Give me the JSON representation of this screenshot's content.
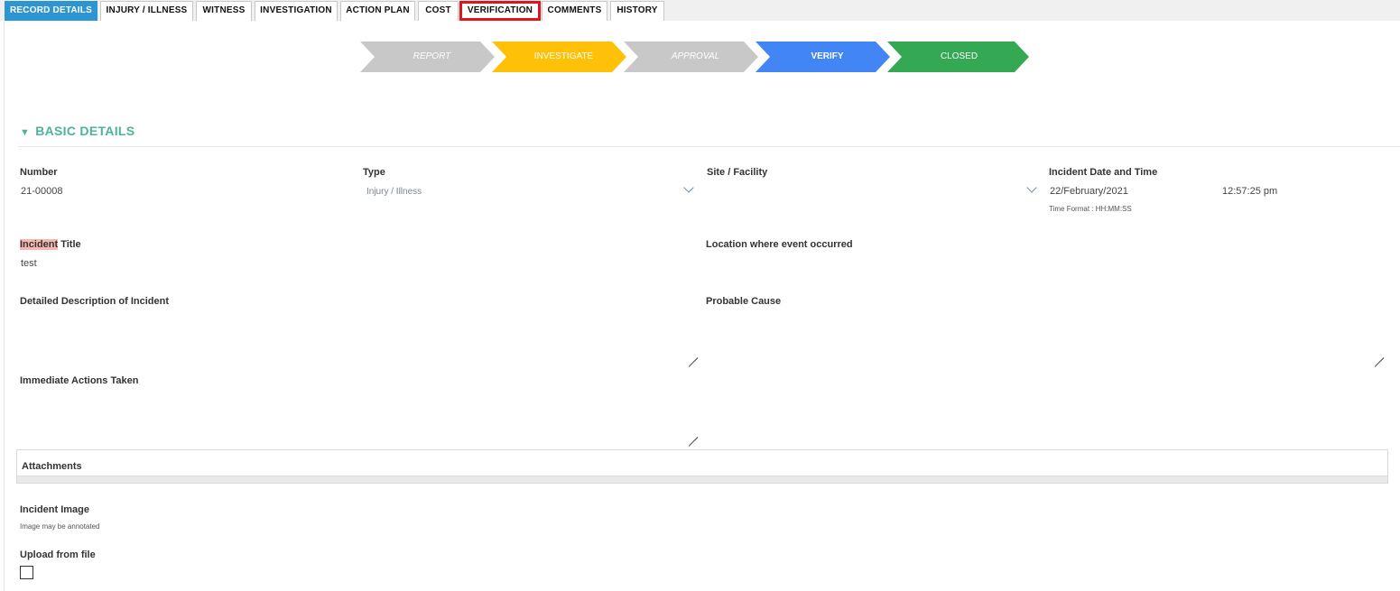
{
  "tabs": [
    {
      "label": "RECORD DETAILS",
      "state": "active"
    },
    {
      "label": "INJURY / ILLNESS",
      "state": "normal"
    },
    {
      "label": "WITNESS",
      "state": "normal"
    },
    {
      "label": "INVESTIGATION",
      "state": "normal"
    },
    {
      "label": "ACTION PLAN",
      "state": "normal"
    },
    {
      "label": "COST",
      "state": "normal"
    },
    {
      "label": "VERIFICATION",
      "state": "highlighted"
    },
    {
      "label": "COMMENTS",
      "state": "normal"
    },
    {
      "label": "HISTORY",
      "state": "normal"
    }
  ],
  "workflow": [
    {
      "label": "REPORT",
      "color": "#c8c8c8",
      "italic": true,
      "bold": false
    },
    {
      "label": "INVESTIGATE",
      "color": "#ffc107",
      "italic": false,
      "bold": false
    },
    {
      "label": "APPROVAL",
      "color": "#c8c8c8",
      "italic": true,
      "bold": false
    },
    {
      "label": "VERIFY",
      "color": "#4285f4",
      "italic": false,
      "bold": true
    },
    {
      "label": "CLOSED",
      "color": "#34a853",
      "italic": false,
      "bold": false
    }
  ],
  "section": {
    "title": "BASIC DETAILS",
    "toggle_icon": "triangle-down-icon",
    "color": "#4db39a"
  },
  "fields": {
    "number": {
      "label": "Number",
      "value": "21-00008"
    },
    "type": {
      "label": "Type",
      "value": "Injury / Illness"
    },
    "site": {
      "label": "Site / Facility",
      "value": ""
    },
    "incident_datetime": {
      "label": "Incident Date and Time",
      "date": "22/February/2021",
      "time": "12:57:25 pm",
      "hint": "Time Format : HH:MM:SS"
    },
    "incident_title": {
      "label_highlight": "Incident",
      "label_rest": " Title",
      "value": "test"
    },
    "location": {
      "label": "Location where event occurred",
      "value": ""
    },
    "description": {
      "label": "Detailed Description of Incident",
      "value": ""
    },
    "probable_cause": {
      "label": "Probable Cause",
      "value": ""
    },
    "immediate_actions": {
      "label": "Immediate Actions Taken",
      "value": ""
    }
  },
  "attachments": {
    "label": "Attachments"
  },
  "incident_image": {
    "label": "Incident Image",
    "hint": "Image may be annotated"
  },
  "upload": {
    "label": "Upload from file",
    "checked": false
  },
  "colors": {
    "tab_active": "#2e95d3",
    "highlight_border": "#e0141b",
    "label_highlight": "#f6b7b3"
  }
}
